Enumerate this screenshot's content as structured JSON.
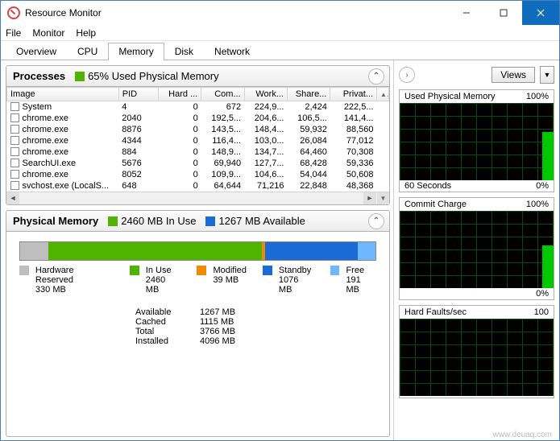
{
  "window": {
    "title": "Resource Monitor"
  },
  "menu": {
    "file": "File",
    "monitor": "Monitor",
    "help": "Help"
  },
  "tabs": {
    "overview": "Overview",
    "cpu": "CPU",
    "memory": "Memory",
    "disk": "Disk",
    "network": "Network"
  },
  "processes": {
    "title": "Processes",
    "usage_text": "65% Used Physical Memory",
    "columns": {
      "image": "Image",
      "pid": "PID",
      "hard": "Hard ...",
      "commit": "Com...",
      "working": "Work...",
      "share": "Share...",
      "private": "Privat..."
    },
    "rows": [
      {
        "image": "System",
        "pid": "4",
        "hard": "0",
        "commit": "672",
        "working": "224,9...",
        "share": "2,424",
        "private": "222,5..."
      },
      {
        "image": "chrome.exe",
        "pid": "2040",
        "hard": "0",
        "commit": "192,5...",
        "working": "204,6...",
        "share": "106,5...",
        "private": "141,4..."
      },
      {
        "image": "chrome.exe",
        "pid": "8876",
        "hard": "0",
        "commit": "143,5...",
        "working": "148,4...",
        "share": "59,932",
        "private": "88,560"
      },
      {
        "image": "chrome.exe",
        "pid": "4344",
        "hard": "0",
        "commit": "116,4...",
        "working": "103,0...",
        "share": "26,084",
        "private": "77,012"
      },
      {
        "image": "chrome.exe",
        "pid": "884",
        "hard": "0",
        "commit": "148,9...",
        "working": "134,7...",
        "share": "64,460",
        "private": "70,308"
      },
      {
        "image": "SearchUI.exe",
        "pid": "5676",
        "hard": "0",
        "commit": "69,940",
        "working": "127,7...",
        "share": "68,428",
        "private": "59,336"
      },
      {
        "image": "chrome.exe",
        "pid": "8052",
        "hard": "0",
        "commit": "109,9...",
        "working": "104,6...",
        "share": "54,044",
        "private": "50,608"
      },
      {
        "image": "svchost.exe (LocalS...",
        "pid": "648",
        "hard": "0",
        "commit": "64,644",
        "working": "71,216",
        "share": "22,848",
        "private": "48,368"
      }
    ]
  },
  "physical_memory": {
    "title": "Physical Memory",
    "in_use_text": "2460 MB In Use",
    "available_text": "1267 MB Available",
    "legend": {
      "hardware_reserved": {
        "label": "Hardware Reserved",
        "value": "330 MB",
        "color": "#bfbfbf"
      },
      "in_use": {
        "label": "In Use",
        "value": "2460 MB",
        "color": "#4fb400"
      },
      "modified": {
        "label": "Modified",
        "value": "39 MB",
        "color": "#f08a00"
      },
      "standby": {
        "label": "Standby",
        "value": "1076 MB",
        "color": "#1a6bd6"
      },
      "free": {
        "label": "Free",
        "value": "191 MB",
        "color": "#6fb7ff"
      }
    },
    "stats": {
      "available": {
        "label": "Available",
        "value": "1267 MB"
      },
      "cached": {
        "label": "Cached",
        "value": "1115 MB"
      },
      "total": {
        "label": "Total",
        "value": "3766 MB"
      },
      "installed": {
        "label": "Installed",
        "value": "4096 MB"
      }
    }
  },
  "right": {
    "views": "Views",
    "charts": [
      {
        "title": "Used Physical Memory",
        "max": "100%",
        "footer_left": "60 Seconds",
        "footer_right": "0%"
      },
      {
        "title": "Commit Charge",
        "max": "100%",
        "footer_left": "",
        "footer_right": "0%"
      },
      {
        "title": "Hard Faults/sec",
        "max": "100",
        "footer_left": "",
        "footer_right": ""
      }
    ]
  },
  "watermark": "www.deuaq.com",
  "chart_data": {
    "type": "line",
    "title": "Resource Monitor memory charts (~60s trailing)",
    "series": [
      {
        "name": "Used Physical Memory (%)",
        "values": [
          65
        ],
        "ylim": [
          0,
          100
        ]
      },
      {
        "name": "Commit Charge (%)",
        "values": [
          55
        ],
        "ylim": [
          0,
          100
        ]
      },
      {
        "name": "Hard Faults/sec",
        "values": [
          0
        ],
        "ylim": [
          0,
          100
        ]
      }
    ],
    "xlabel": "60 Seconds",
    "ylabel": ""
  }
}
